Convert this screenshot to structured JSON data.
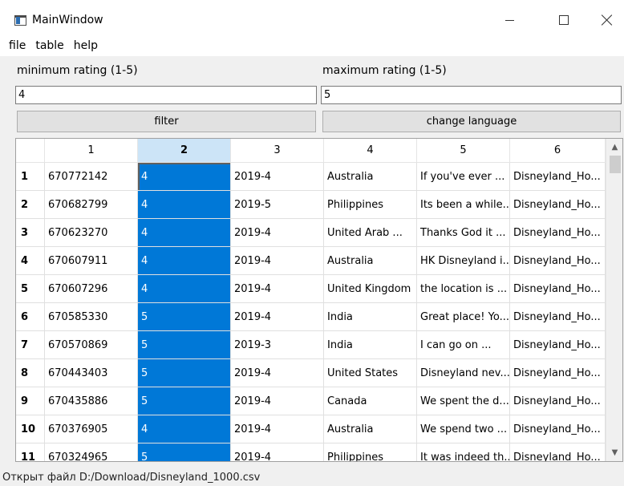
{
  "window": {
    "title": "MainWindow",
    "icon": "app-window-icon",
    "controls": {
      "minimize": "minimize-icon",
      "maximize": "maximize-icon",
      "close": "close-icon"
    }
  },
  "menu": [
    "file",
    "table",
    "help"
  ],
  "filters": {
    "min_label": "minimum rating (1-5)",
    "min_value": "4",
    "max_label": "maximum rating (1-5)",
    "max_value": "5",
    "filter_button": "filter",
    "language_button": "change language"
  },
  "table": {
    "columns": [
      "1",
      "2",
      "3",
      "4",
      "5",
      "6"
    ],
    "selected_column": 1,
    "rows": [
      [
        "1",
        "670772142",
        "4",
        "2019-4",
        "Australia",
        "If you've ever ...",
        "Disneyland_Ho..."
      ],
      [
        "2",
        "670682799",
        "4",
        "2019-5",
        "Philippines",
        "Its been a while...",
        "Disneyland_Ho..."
      ],
      [
        "3",
        "670623270",
        "4",
        "2019-4",
        "United Arab ...",
        "Thanks God it ...",
        "Disneyland_Ho..."
      ],
      [
        "4",
        "670607911",
        "4",
        "2019-4",
        "Australia",
        "HK Disneyland i...",
        "Disneyland_Ho..."
      ],
      [
        "5",
        "670607296",
        "4",
        "2019-4",
        "United Kingdom",
        "the location is ...",
        "Disneyland_Ho..."
      ],
      [
        "6",
        "670585330",
        "5",
        "2019-4",
        "India",
        "Great place! Yo...",
        "Disneyland_Ho..."
      ],
      [
        "7",
        "670570869",
        "5",
        "2019-3",
        "India",
        "I can go on ...",
        "Disneyland_Ho..."
      ],
      [
        "8",
        "670443403",
        "5",
        "2019-4",
        "United States",
        "Disneyland nev...",
        "Disneyland_Ho..."
      ],
      [
        "9",
        "670435886",
        "5",
        "2019-4",
        "Canada",
        "We spent the d...",
        "Disneyland_Ho..."
      ],
      [
        "10",
        "670376905",
        "4",
        "2019-4",
        "Australia",
        "We spend two ...",
        "Disneyland_Ho..."
      ],
      [
        "11",
        "670324965",
        "5",
        "2019-4",
        "Philippines",
        "It was indeed th...",
        "Disneyland_Ho..."
      ]
    ],
    "scroll_up_icon": "chevron-up-icon",
    "scroll_down_icon": "chevron-down-icon"
  },
  "status": "Открыт файл D:/Download/Disneyland_1000.csv",
  "colors": {
    "selection": "#0078d7",
    "header_selected": "#cce4f7"
  }
}
